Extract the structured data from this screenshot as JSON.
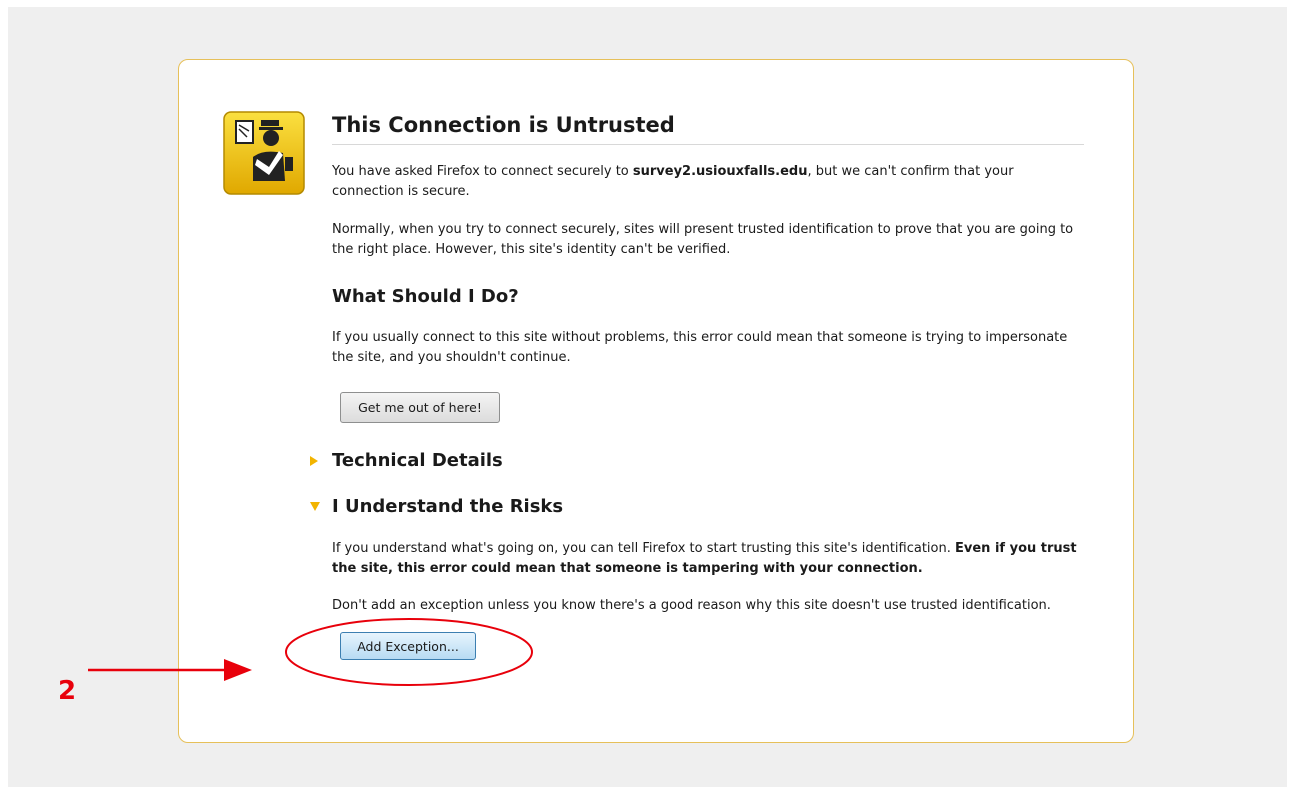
{
  "page": {
    "title": "This Connection is Untrusted",
    "intro": {
      "prefix": "You have asked Firefox to connect securely to ",
      "host": "survey2.usiouxfalls.edu",
      "suffix": ", but we can't confirm that your connection is secure."
    },
    "normally": "Normally, when you try to connect securely, sites will present trusted identification to prove that you are going to the right place. However, this site's identity can't be verified.",
    "what_heading": "What Should I Do?",
    "what_text": "If you usually connect to this site without problems, this error could mean that someone is trying to impersonate the site, and you shouldn't continue.",
    "get_out_label": "Get me out of here!",
    "technical_label": "Technical Details",
    "risks_label": "I Understand the Risks",
    "risks_text": {
      "plain": "If you understand what's going on, you can tell Firefox to start trusting this site's identification. ",
      "bold": "Even if you trust the site, this error could mean that someone is tampering with your connection."
    },
    "dont_add": "Don't add an exception unless you know there's a good reason why this site doesn't use trusted identification.",
    "add_exception_label": "Add Exception..."
  },
  "annotation": {
    "step": "2",
    "color": "#e8000b"
  },
  "colors": {
    "box_border": "#e6c05a",
    "badge": "#f2c300",
    "arrow": "#f2b400"
  },
  "icons": {
    "badge": "identity-officer-icon",
    "technical_toggle": "triangle-right-icon",
    "risks_toggle": "triangle-down-icon"
  }
}
